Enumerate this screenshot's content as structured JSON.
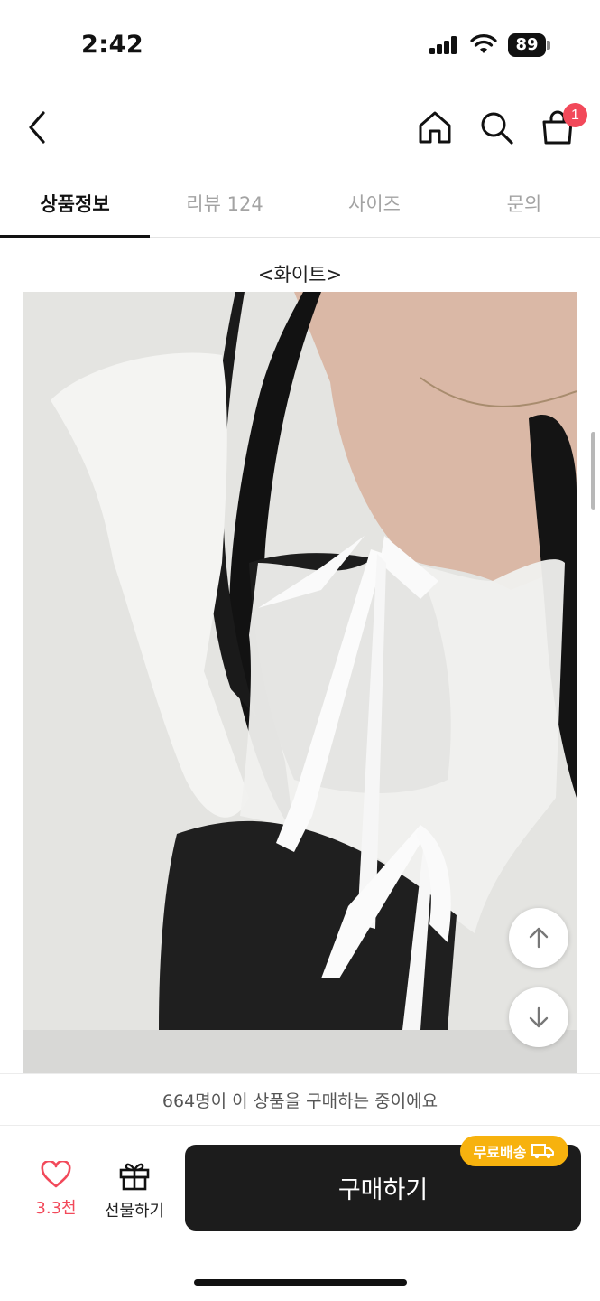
{
  "status": {
    "time": "2:42",
    "battery": "89"
  },
  "nav": {
    "cart_count": "1"
  },
  "tabs": [
    {
      "label": "상품정보",
      "active": true
    },
    {
      "label": "리뷰 124",
      "active": false
    },
    {
      "label": "사이즈",
      "active": false
    },
    {
      "label": "문의",
      "active": false
    }
  ],
  "product": {
    "option_label": "<화이트>"
  },
  "notice": {
    "buyers_text": "664명이 이 상품을 구매하는 중이에요"
  },
  "actions": {
    "like_count": "3.3천",
    "gift_label": "선물하기",
    "buy_label": "구매하기",
    "shipping_badge": "무료배송"
  },
  "colors": {
    "accent_red": "#f2495a",
    "badge_yellow": "#f7b20e",
    "buy_button": "#1c1c1c"
  }
}
